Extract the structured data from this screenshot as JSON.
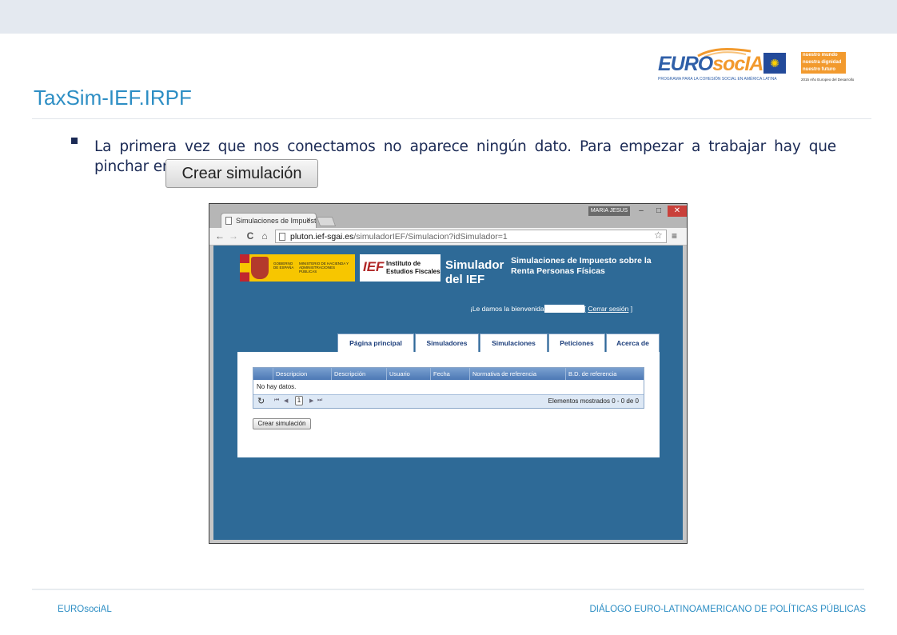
{
  "slide": {
    "title": "TaxSim-IEF.IRPF",
    "bullet_text": "La primera vez que nos conectamos no aparece ningún dato. Para empezar a trabajar hay que pinchar en el botón",
    "big_button_label": "Crear simulación"
  },
  "logos": {
    "eurosocial_prefix": "EURO",
    "eurosocial_suffix": "socIAL",
    "eurosocial_tagline": "PROGRAMA PARA LA COHESIÓN SOCIAL EN AMÉRICA LATINA",
    "mundo_lines": [
      "nuestro mundo",
      "nuestra dignidad",
      "nuestro futuro"
    ],
    "mundo_tagline": "2015 Año Europeo del Desarrollo"
  },
  "browser": {
    "tab_title": "Simulaciones de Impuesto",
    "tab_close": "×",
    "user_badge": "MARIA JESUS",
    "window_controls": {
      "minimize": "–",
      "maximize": "□",
      "close": "✕"
    },
    "nav": {
      "back": "←",
      "forward": "→",
      "reload": "C",
      "home": "⌂"
    },
    "url_host": "pluton.ief-sgai.es",
    "url_path": "/simuladorIEF/Simulacion?idSimulador=1",
    "star_icon": "☆",
    "menu_icon": "≡"
  },
  "site": {
    "gobierno_text": "GOBIERNO DE ESPAÑA",
    "ministerio_text": "MINISTERIO DE HACIENDA Y ADMINISTRACIONES PÚBLICAS",
    "ief_mark": "IEF",
    "ief_text": "Instituto de Estudios Fiscales",
    "sim_title": "Simulador del IEF",
    "sim_subtitle": "Simulaciones de Impuesto sobre la Renta Personas Físicas",
    "welcome_text": "¡Le damos la bienvenida",
    "logout_open": "[ ",
    "logout_link": "Cerrar sesión",
    "logout_close": " ]",
    "tabs": [
      "Página principal",
      "Simuladores",
      "Simulaciones",
      "Peticiones",
      "Acerca de"
    ]
  },
  "grid": {
    "columns": [
      "Descripcion",
      "Descripción",
      "Usuario",
      "Fecha",
      "Normativa de referencia",
      "B.D. de referencia"
    ],
    "empty_message": "No hay datos.",
    "refresh_icon": "↻",
    "pager_first": "⏮",
    "pager_prev": "◀",
    "current_page": "1",
    "pager_next": "▶",
    "pager_last": "⏭",
    "count_text": "Elementos mostrados 0 - 0 de 0"
  },
  "page_button_label": "Crear simulación",
  "footer": {
    "left": "EUROsociAL",
    "right": "DIÁLOGO EURO-LATINOAMERICANO DE POLÍTICAS PÚBLICAS"
  },
  "colors": {
    "title_blue": "#2d8ec4",
    "text_navy": "#1b2a55",
    "site_background": "#2e6a97",
    "brand_orange": "#f29a2e"
  }
}
